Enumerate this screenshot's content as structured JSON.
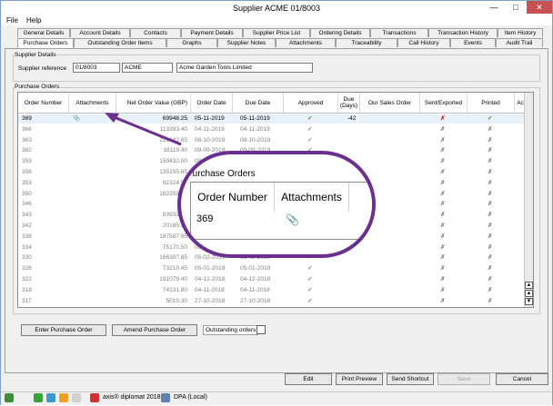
{
  "window": {
    "title": "Supplier ACME 01/8003",
    "minimize": "—",
    "maximize": "□",
    "close": "✕"
  },
  "menu": [
    "File",
    "Help"
  ],
  "tabs_row1": [
    "General Details",
    "Account Details",
    "Contacts",
    "Payment Details",
    "Supplier Price List",
    "Ordering Details",
    "Transactions",
    "Transaction History",
    "Item History"
  ],
  "tabs_row2": [
    "Purchase Orders",
    "Outstanding Order Items",
    "Graphs",
    "Supplier Notes",
    "Attachments",
    "Traceability",
    "Call History",
    "Events",
    "Audit Trail"
  ],
  "supplier": {
    "group_label": "Supplier Details",
    "ref_label": "Supplier reference",
    "ref": "01/8003",
    "code": "ACME",
    "name": "Acme Garden Tools Limited"
  },
  "orders": {
    "group_label": "Purchase Orders",
    "columns": [
      "Order Number",
      "Attachments",
      "Net Order Value (GBP)",
      "Order Date",
      "Due Date",
      "Approved",
      "Due (Days)",
      "Our Sales Order",
      "Sent/Exported",
      "Printed",
      "Ac"
    ],
    "rows": [
      {
        "num": "369",
        "att": true,
        "value": "69948.25",
        "odate": "05-11-2019",
        "ddate": "05-11-2019",
        "approved": true,
        "due": "-42",
        "sent": false,
        "printed": true
      },
      {
        "num": "366",
        "value": "113393.40",
        "odate": "04-11-2019",
        "ddate": "04-11-2019",
        "approved": true,
        "sent": false,
        "printed": false
      },
      {
        "num": "363",
        "value": "219682.65",
        "odate": "08-10-2019",
        "ddate": "08-10-2019",
        "approved": true,
        "sent": false,
        "printed": false
      },
      {
        "num": "362",
        "value": "18119.40",
        "odate": "09-09-2019",
        "ddate": "09-09-2019",
        "approved": true,
        "sent": false,
        "printed": false
      },
      {
        "num": "359",
        "value": "159432.00",
        "odate": "09-09-2019",
        "ddate": "",
        "approved": false,
        "sent": false,
        "printed": false
      },
      {
        "num": "356",
        "value": "135155.65",
        "odate": "",
        "ddate": "",
        "approved": false,
        "sent": false,
        "printed": false
      },
      {
        "num": "353",
        "value": "92324.95",
        "odate": "",
        "ddate": "",
        "approved": false,
        "sent": false,
        "printed": false
      },
      {
        "num": "350",
        "value": "182259.95",
        "odate": "",
        "ddate": "",
        "approved": false,
        "sent": false,
        "printed": false
      },
      {
        "num": "346",
        "value": "",
        "odate": "",
        "ddate": "",
        "approved": false,
        "sent": false,
        "printed": false
      },
      {
        "num": "343",
        "value": "83932.35",
        "odate": "",
        "ddate": "",
        "approved": false,
        "sent": false,
        "printed": false
      },
      {
        "num": "342",
        "value": "20185.35",
        "odate": "",
        "ddate": "",
        "approved": false,
        "sent": false,
        "printed": false
      },
      {
        "num": "338",
        "value": "187587.95",
        "odate": "",
        "ddate": "",
        "approved": false,
        "sent": false,
        "printed": false
      },
      {
        "num": "334",
        "value": "75170.50",
        "odate": "03-03-2019",
        "ddate": "",
        "approved": false,
        "sent": false,
        "printed": false
      },
      {
        "num": "330",
        "value": "166307.85",
        "odate": "05-02-2019",
        "ddate": "05-02-2019",
        "approved": true,
        "sent": false,
        "printed": false
      },
      {
        "num": "326",
        "value": "73210.45",
        "odate": "05-01-2019",
        "ddate": "05-01-2019",
        "approved": true,
        "sent": false,
        "printed": false
      },
      {
        "num": "322",
        "value": "191079.40",
        "odate": "04-12-2018",
        "ddate": "04-12-2018",
        "approved": true,
        "sent": false,
        "printed": false
      },
      {
        "num": "318",
        "value": "74131.80",
        "odate": "04-11-2018",
        "ddate": "04-11-2018",
        "approved": true,
        "sent": false,
        "printed": false
      },
      {
        "num": "317",
        "value": "5010.30",
        "odate": "27-10-2018",
        "ddate": "27-10-2018",
        "approved": true,
        "sent": false,
        "printed": false
      }
    ]
  },
  "zoom": {
    "title": "Purchase Orders",
    "col1": "Order Number",
    "col2": "Attachments",
    "row_num": "369"
  },
  "buttons": {
    "enter": "Enter Purchase Order",
    "amend": "Amend Purchase Order",
    "outstanding": "Outstanding orders",
    "edit": "Edit",
    "print_preview": "Print Preview",
    "send_shortcut": "Send Shortcut",
    "save": "Save",
    "cancel": "Cancel"
  },
  "status": {
    "app": "axis® diplomat 2018",
    "db": "DPA (Local)"
  },
  "colors": {
    "tick": "#1e9e1e",
    "cross": "#e01010",
    "callout": "#6a2f8f"
  }
}
